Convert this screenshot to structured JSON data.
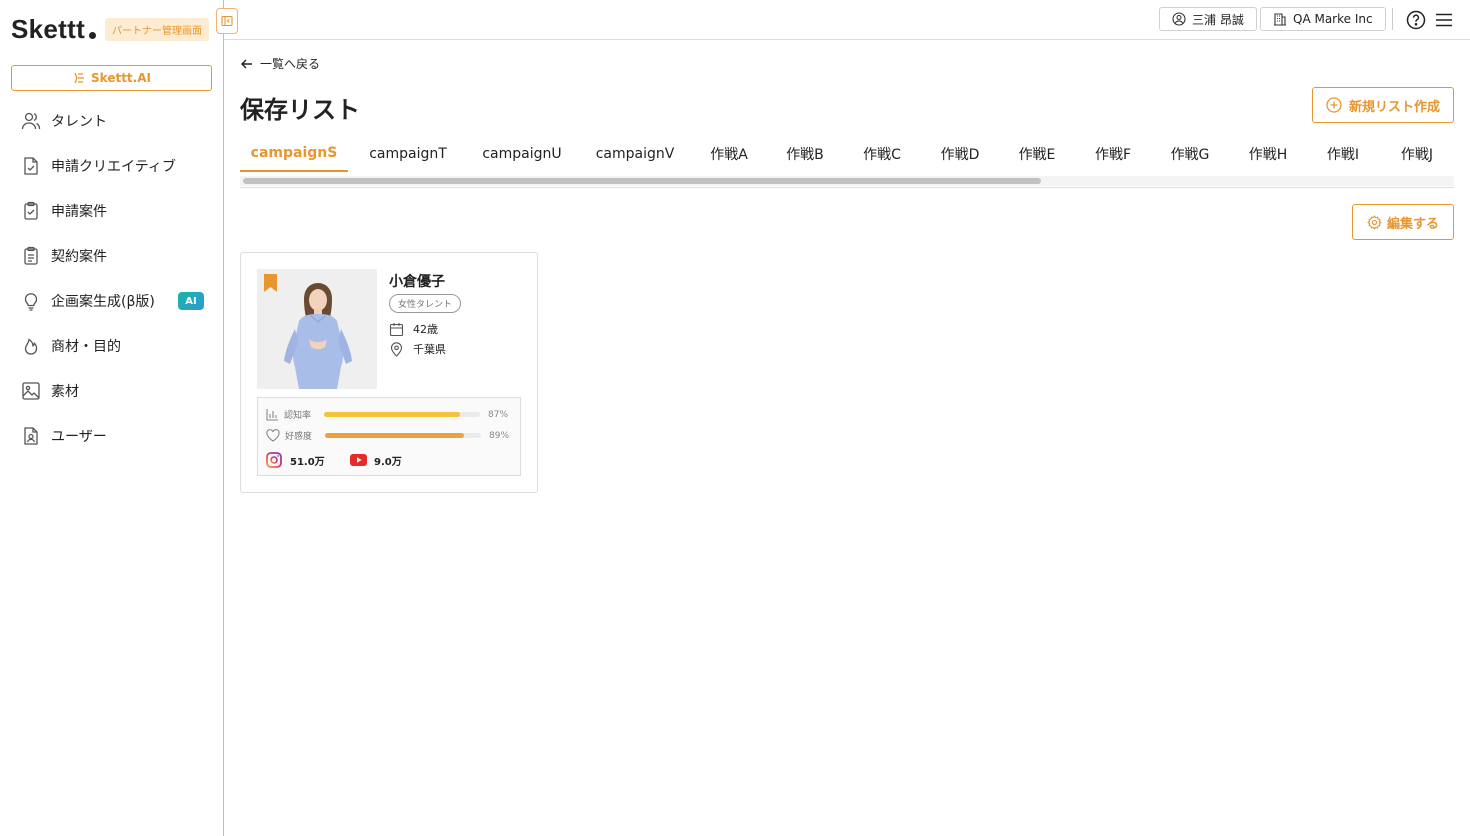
{
  "sidebar": {
    "logo": "Skettt",
    "partner_badge": "パートナー管理画面",
    "ai_button": "Skettt.AI",
    "items": [
      {
        "label": "タレント",
        "icon": "users-icon"
      },
      {
        "label": "申請クリエイティブ",
        "icon": "document-check-icon"
      },
      {
        "label": "申請案件",
        "icon": "clipboard-check-icon"
      },
      {
        "label": "契約案件",
        "icon": "clipboard-list-icon"
      },
      {
        "label": "企画案生成(β版)",
        "icon": "lightbulb-icon",
        "badge": "AI"
      },
      {
        "label": "商材・目的",
        "icon": "flame-icon"
      },
      {
        "label": "素材",
        "icon": "image-icon"
      },
      {
        "label": "ユーザー",
        "icon": "user-document-icon"
      }
    ]
  },
  "topbar": {
    "user_name": "三浦 昂誠",
    "company_name": "QA Marke Inc"
  },
  "page": {
    "back_label": "一覧へ戻る",
    "title": "保存リスト",
    "new_list_button": "新規リスト作成",
    "edit_button": "編集する",
    "tabs": [
      "campaignS",
      "campaignT",
      "campaignU",
      "campaignV",
      "作戦A",
      "作戦B",
      "作戦C",
      "作戦D",
      "作戦E",
      "作戦F",
      "作戦G",
      "作戦H",
      "作戦I",
      "作戦J"
    ],
    "active_tab": 0
  },
  "card": {
    "name": "小倉優子",
    "category": "女性タレント",
    "age": "42歳",
    "location": "千葉県",
    "stats": [
      {
        "label": "認知率",
        "value": 87,
        "display": "87%",
        "color": "#f5c33b"
      },
      {
        "label": "好感度",
        "value": 89,
        "display": "89%",
        "color": "#eba23e"
      }
    ],
    "instagram": "51.0万",
    "youtube": "9.0万"
  },
  "colors": {
    "accent": "#e8962e",
    "border": "#dddddd"
  }
}
